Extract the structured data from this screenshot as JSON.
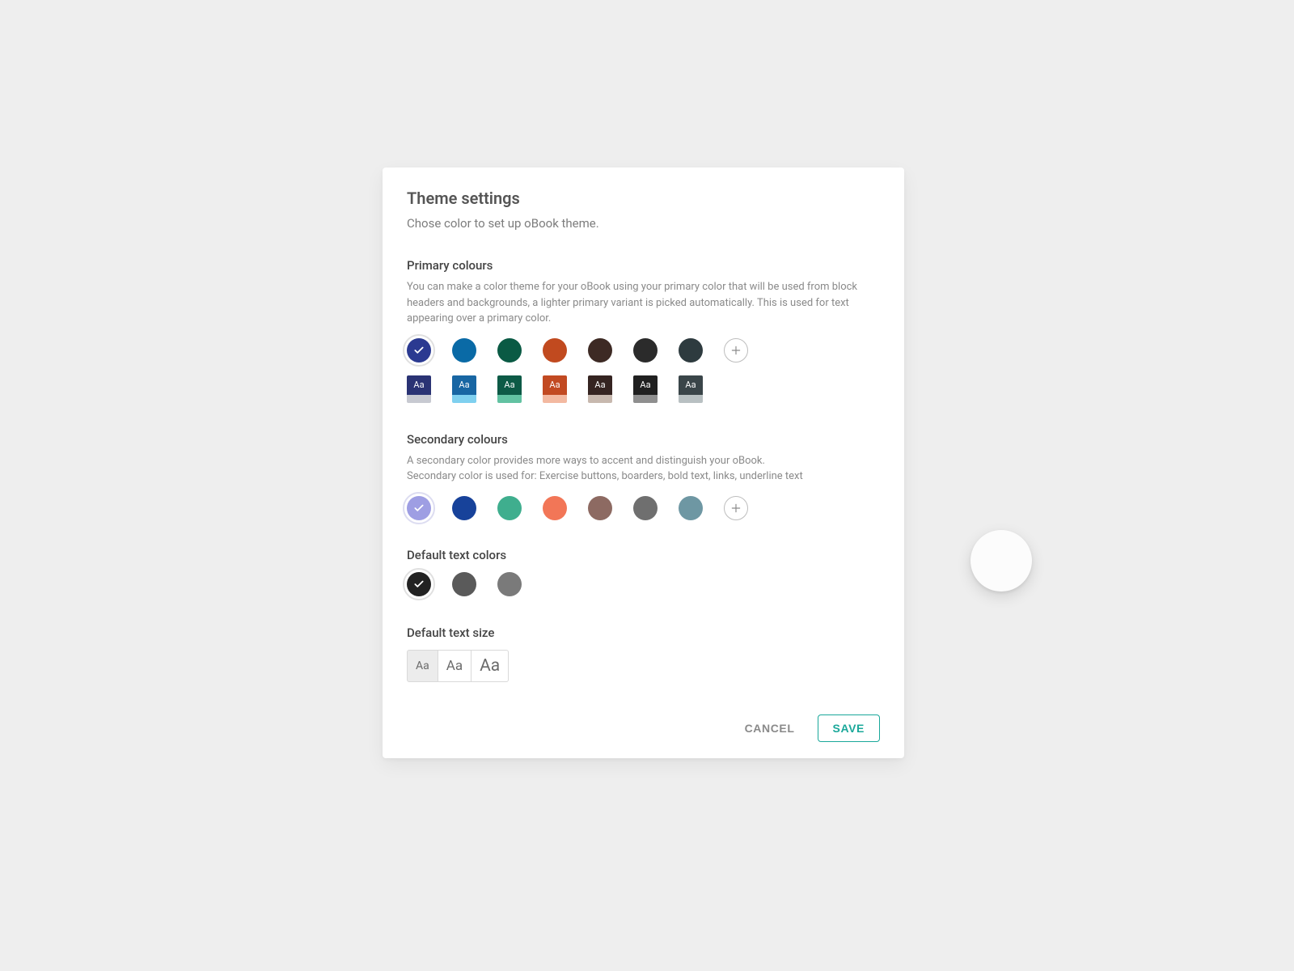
{
  "dialog": {
    "title": "Theme settings",
    "subtitle": "Chose color to set up oBook theme."
  },
  "primary": {
    "title": "Primary colours",
    "description": "You can make a color theme for your oBook using your primary color that will be used from block headers and backgrounds, a lighter primary variant is picked automatically. This is used for text appearing over a primary color.",
    "swatches": [
      {
        "color": "#2b3a91",
        "selected": true
      },
      {
        "color": "#0a6aa6",
        "selected": false
      },
      {
        "color": "#0a5a44",
        "selected": false
      },
      {
        "color": "#c14a1f",
        "selected": false
      },
      {
        "color": "#3d2a24",
        "selected": false
      },
      {
        "color": "#2b2b2b",
        "selected": false
      },
      {
        "color": "#2e3b3f",
        "selected": false
      }
    ],
    "previews": [
      {
        "top": "#2a3374",
        "bottom": "#c7c9d1",
        "label": "Aa",
        "selected": true
      },
      {
        "top": "#1866a3",
        "bottom": "#7fd0ef",
        "label": "Aa",
        "selected": false
      },
      {
        "top": "#0d5a46",
        "bottom": "#62c2a2",
        "label": "Aa",
        "selected": false
      },
      {
        "top": "#c24a22",
        "bottom": "#f3b9a1",
        "label": "Aa",
        "selected": false
      },
      {
        "top": "#352421",
        "bottom": "#c7b8ae",
        "label": "Aa",
        "selected": false
      },
      {
        "top": "#202020",
        "bottom": "#8f8f8f",
        "label": "Aa",
        "selected": false
      },
      {
        "top": "#3a4549",
        "bottom": "#b8c0c2",
        "label": "Aa",
        "selected": false
      }
    ]
  },
  "secondary": {
    "title": "Secondary colours",
    "desc_line1": "A secondary color provides more ways to accent and distinguish your oBook.",
    "desc_line2": "Secondary color is used for: Exercise buttons, boarders, bold text, links, underline text",
    "swatches": [
      {
        "color": "#9e9ee3",
        "selected": true
      },
      {
        "color": "#17429a",
        "selected": false
      },
      {
        "color": "#3fae8e",
        "selected": false
      },
      {
        "color": "#f27657",
        "selected": false
      },
      {
        "color": "#8d6a62",
        "selected": false
      },
      {
        "color": "#6f6f6f",
        "selected": false
      },
      {
        "color": "#6e97a3",
        "selected": false
      }
    ]
  },
  "text_colors": {
    "title": "Default text colors",
    "swatches": [
      {
        "color": "#222222",
        "selected": true
      },
      {
        "color": "#5a5a5a",
        "selected": false
      },
      {
        "color": "#7a7a7a",
        "selected": false
      }
    ]
  },
  "text_size": {
    "title": "Default text size",
    "options": [
      {
        "label": "Aa",
        "size": "small",
        "selected": true
      },
      {
        "label": "Aa",
        "size": "medium",
        "selected": false
      },
      {
        "label": "Aa",
        "size": "large",
        "selected": false
      }
    ]
  },
  "footer": {
    "cancel": "CANCEL",
    "save": "SAVE"
  },
  "accent": {
    "teal": "#1aa89a"
  }
}
